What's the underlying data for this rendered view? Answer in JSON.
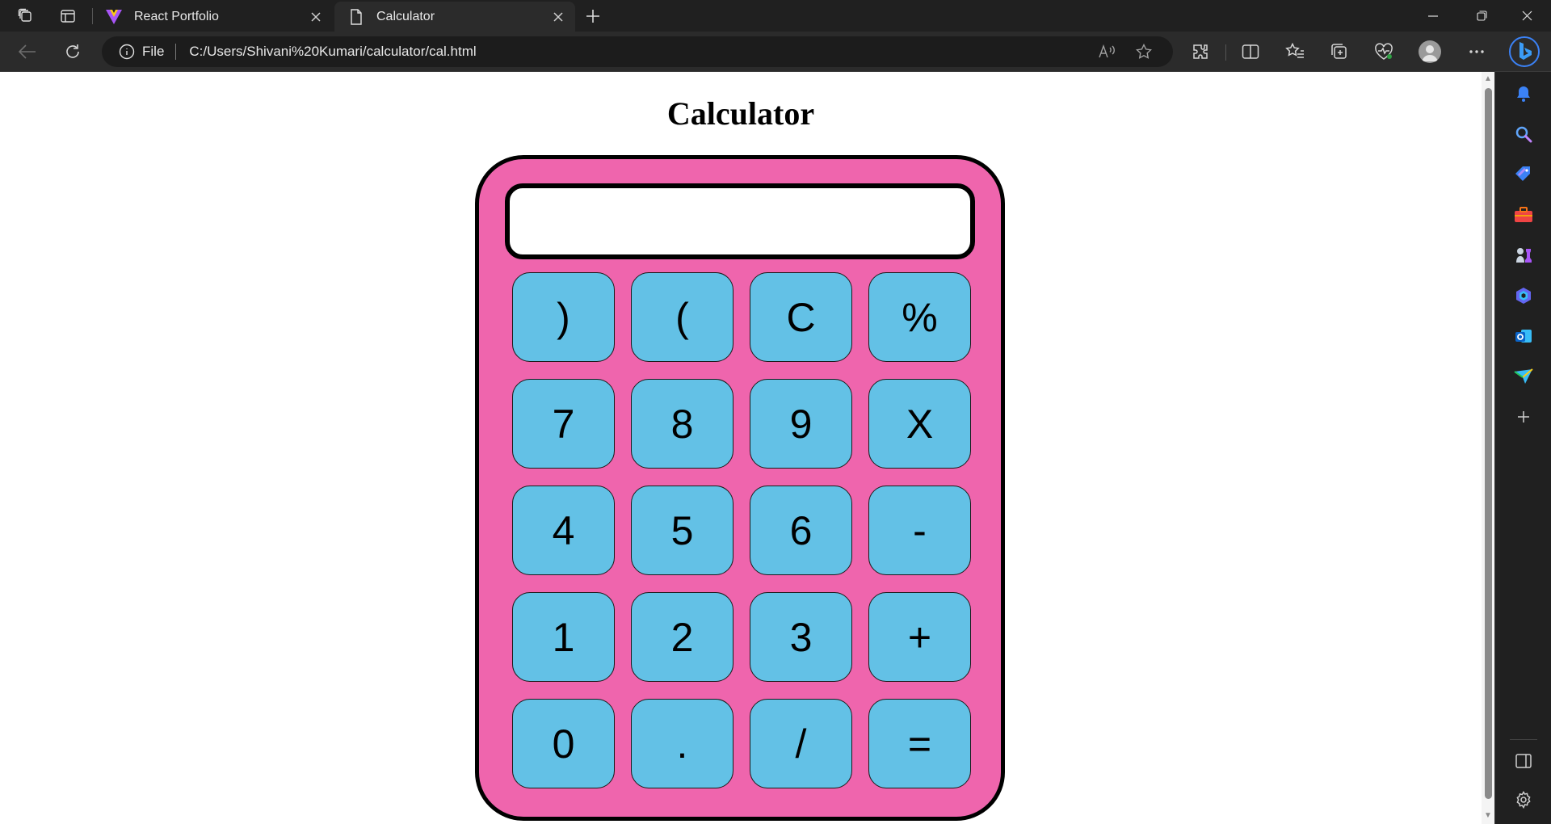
{
  "browser": {
    "tabs": [
      {
        "title": "React Portfolio",
        "active": false
      },
      {
        "title": "Calculator",
        "active": true
      }
    ],
    "address": {
      "scheme_label": "File",
      "url": "C:/Users/Shivani%20Kumari/calculator/cal.html"
    }
  },
  "page": {
    "title": "Calculator",
    "display_value": ""
  },
  "calculator": {
    "keys": [
      [
        ")",
        "(",
        "C",
        "%"
      ],
      [
        "7",
        "8",
        "9",
        "X"
      ],
      [
        "4",
        "5",
        "6",
        "-"
      ],
      [
        "1",
        "2",
        "3",
        "+"
      ],
      [
        "0",
        ".",
        "/",
        "="
      ]
    ]
  },
  "colors": {
    "calculator_body": "#ef65ad",
    "key_fill": "#63c1e6",
    "chrome_dark": "#202020",
    "toolbar": "#2b2b2b"
  }
}
